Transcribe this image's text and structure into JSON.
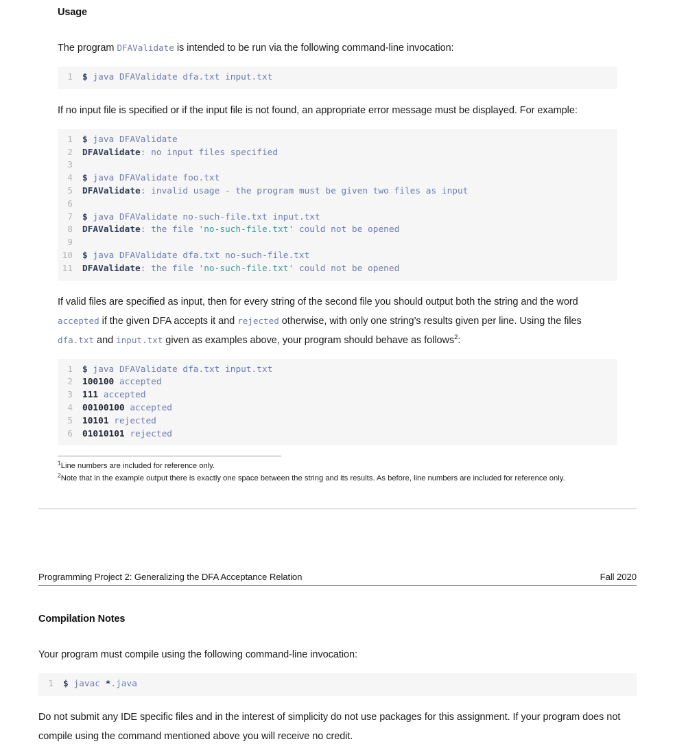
{
  "document": {
    "type": "assignment-handout",
    "running_header": {
      "title": "Programming Project 2: Generalizing the DFA Acceptance Relation",
      "term": "Fall 2020"
    }
  },
  "sections": [
    {
      "id": "usage",
      "heading": "Usage"
    },
    {
      "id": "compilation-notes",
      "heading": "Compilation Notes"
    }
  ],
  "usage": {
    "heading": "Usage",
    "intro": {
      "before": "The program ",
      "code": "DFAValidate",
      "after": " is intended to be run via the following command-line invocation:"
    },
    "code1": {
      "lines": [
        {
          "n": "1",
          "prompt": "$",
          "text": " java DFAValidate dfa.txt input.txt"
        }
      ]
    },
    "para_error": "If no input file is specified or if the input file is not found, an appropriate error message must be displayed. For example:",
    "code2": {
      "lines": [
        {
          "n": "1",
          "kind": "cmd",
          "prompt": "$",
          "text": " java DFAValidate"
        },
        {
          "n": "2",
          "kind": "out",
          "name": "DFAValidate",
          "text": ": no input files specified"
        },
        {
          "n": "3",
          "kind": "blank",
          "text": ""
        },
        {
          "n": "4",
          "kind": "cmd",
          "prompt": "$",
          "text": " java DFAValidate foo.txt"
        },
        {
          "n": "5",
          "kind": "out",
          "name": "DFAValidate",
          "text": ": invalid usage - the program must be given two files as input"
        },
        {
          "n": "6",
          "kind": "blank",
          "text": ""
        },
        {
          "n": "7",
          "kind": "cmd",
          "prompt": "$",
          "text": " java DFAValidate no-such-file.txt input.txt"
        },
        {
          "n": "8",
          "kind": "out-str",
          "name": "DFAValidate",
          "pre": ": the file ",
          "str": "'no-such-file.txt'",
          "post": " could not be opened"
        },
        {
          "n": "9",
          "kind": "blank",
          "text": ""
        },
        {
          "n": "10",
          "kind": "cmd",
          "prompt": "$",
          "text": " java DFAValidate dfa.txt no-such-file.txt"
        },
        {
          "n": "11",
          "kind": "out-str",
          "name": "DFAValidate",
          "pre": ": the file ",
          "str": "'no-such-file.txt'",
          "post": " could not be opened"
        }
      ]
    },
    "para_valid": {
      "seg1": "If valid files are specified as input, then for every string of the second file you should output both the string and the word ",
      "code1": "accepted",
      "seg2": " if the given DFA accepts it and ",
      "code2": "rejected",
      "seg3": " otherwise, with only one string’s results given per line. Using the files ",
      "code3": "dfa.txt",
      "seg4": " and ",
      "code4": "input.txt",
      "seg5": " given as examples above, your program should behave as follows",
      "footnote_marker": "2",
      "seg6": ":"
    },
    "code3": {
      "lines": [
        {
          "n": "1",
          "kind": "cmd",
          "prompt": "$",
          "text": " java DFAValidate dfa.txt input.txt"
        },
        {
          "n": "2",
          "kind": "result",
          "bin": "100100",
          "verdict": " accepted"
        },
        {
          "n": "3",
          "kind": "result",
          "bin": "111",
          "verdict": " accepted"
        },
        {
          "n": "4",
          "kind": "result",
          "bin": "00100100",
          "verdict": " accepted"
        },
        {
          "n": "5",
          "kind": "result",
          "bin": "10101",
          "verdict": " rejected"
        },
        {
          "n": "6",
          "kind": "result",
          "bin": "01010101",
          "verdict": " rejected"
        }
      ]
    },
    "footnotes": [
      {
        "marker": "1",
        "text": "Line numbers are included for reference only."
      },
      {
        "marker": "2",
        "text": "Note that in the example output there is exactly one space between the string and its results. As before, line numbers are included for reference only."
      }
    ]
  },
  "compilation": {
    "heading": "Compilation Notes",
    "para_compile": "Your program must compile using the following command-line invocation:",
    "code4": {
      "lines": [
        {
          "n": "1",
          "prompt": "$",
          "pre": " javac ",
          "op": "*",
          "post": ".java"
        }
      ]
    },
    "para_nocredit": "Do not submit any IDE specific files and in the interest of simplicity do not use packages for this assignment. If your program does not compile using the command mentioned above you will receive no credit."
  },
  "colors": {
    "code_bg": "#f6f6f7",
    "code_text": "#6e7baf",
    "code_emphasis": "#2b3a57",
    "code_string": "#3f9a93",
    "line_number": "#b4b4b8",
    "body_text": "#1b1b1b",
    "rule": "#5c5c5c"
  }
}
